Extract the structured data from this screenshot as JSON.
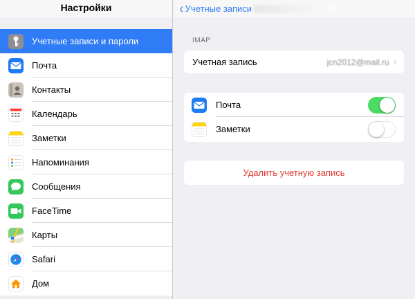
{
  "sidebar": {
    "title": "Настройки",
    "items": [
      {
        "label": "Учетные записи и пароли",
        "icon": "key-icon",
        "color": "#8e8e93",
        "selected": true
      },
      {
        "label": "Почта",
        "icon": "mail-icon",
        "color": "#1e7cf2"
      },
      {
        "label": "Контакты",
        "icon": "contacts-icon",
        "color": "#b9b2a6"
      },
      {
        "label": "Календарь",
        "icon": "calendar-icon",
        "color": "#ffffff"
      },
      {
        "label": "Заметки",
        "icon": "notes-icon",
        "color": "#ffd60a"
      },
      {
        "label": "Напоминания",
        "icon": "reminders-icon",
        "color": "#ffffff"
      },
      {
        "label": "Сообщения",
        "icon": "messages-icon",
        "color": "#34c759"
      },
      {
        "label": "FaceTime",
        "icon": "facetime-icon",
        "color": "#34c759"
      },
      {
        "label": "Карты",
        "icon": "maps-icon",
        "color": "#7fd37a"
      },
      {
        "label": "Safari",
        "icon": "safari-icon",
        "color": "#1e88f0"
      },
      {
        "label": "Дом",
        "icon": "home-icon",
        "color": "#ffffff"
      }
    ]
  },
  "nav": {
    "back_label": "Учетные записи"
  },
  "account": {
    "section_label": "IMAP",
    "row_label": "Учетная запись",
    "row_value": "jcn2012@mail.ru"
  },
  "toggles": [
    {
      "label": "Почта",
      "icon": "mail-icon",
      "on": true
    },
    {
      "label": "Заметки",
      "icon": "notes-icon",
      "on": false
    }
  ],
  "delete_label": "Удалить учетную запись",
  "colors": {
    "accent": "#2f7cf6",
    "switch_on": "#4cd964",
    "destructive": "#e0362c"
  }
}
